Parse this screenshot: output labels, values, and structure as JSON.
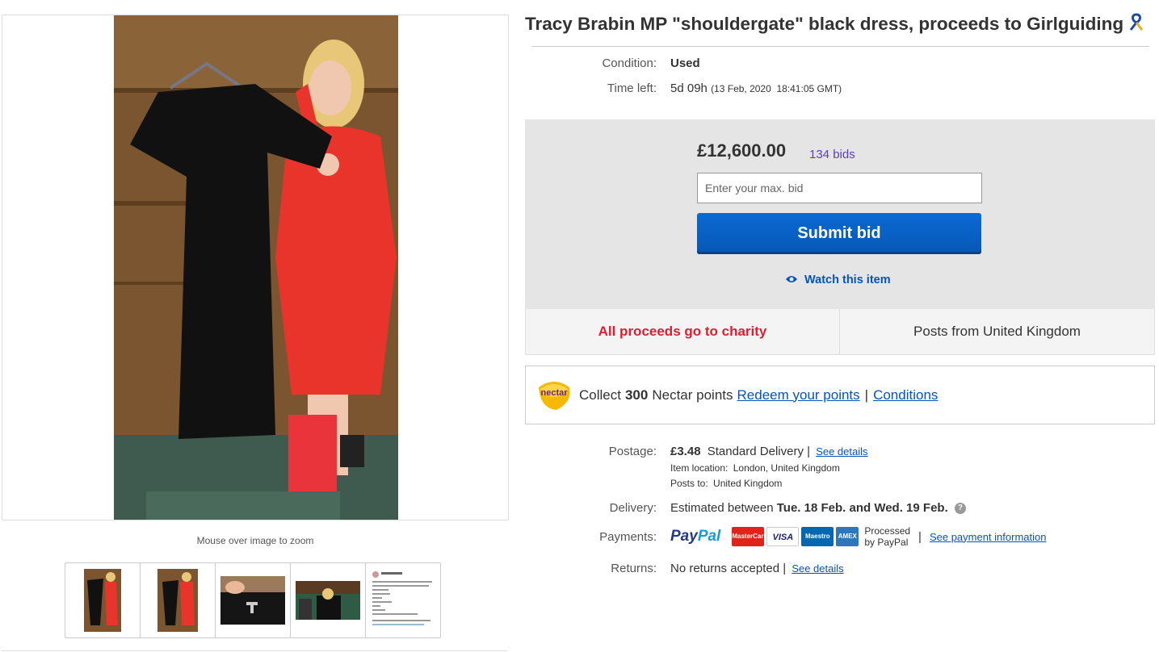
{
  "listing": {
    "title": "Tracy Brabin MP \"shouldergate\" black dress, proceeds to Girlguiding",
    "title_icon": "charity-ribbon-icon"
  },
  "gallery": {
    "zoom_hint": "Mouse over image to zoom",
    "thumbnail_count": 5
  },
  "details": {
    "condition_label": "Condition:",
    "condition_value": "Used",
    "time_left_label": "Time left:",
    "time_left_value": "5d 09h",
    "time_left_end": "(13 Feb, 2020  18:41:05 GMT)"
  },
  "bidding": {
    "current_price": "£12,600.00",
    "bid_count": "134 bids",
    "max_bid_placeholder": "Enter your max. bid",
    "submit_label": "Submit bid",
    "watch_label": "Watch this item"
  },
  "badges": {
    "charity": "All proceeds go to charity",
    "posts_from": "Posts from United Kingdom"
  },
  "nectar": {
    "collect_prefix": "Collect",
    "points": "300",
    "collect_suffix": "Nectar points",
    "redeem_link": "Redeem your points",
    "separator": "|",
    "conditions_link": "Conditions",
    "logo_text": "nectar"
  },
  "postage": {
    "label": "Postage:",
    "price": "£3.48",
    "service": "Standard Delivery |",
    "details_link": "See details",
    "location_label": "Item location:",
    "location_value": "London, United Kingdom",
    "posts_to_label": "Posts to:",
    "posts_to_value": "United Kingdom"
  },
  "delivery": {
    "label": "Delivery:",
    "prefix": "Estimated between",
    "dates": "Tue. 18 Feb. and Wed. 19 Feb.",
    "help_icon": "help-icon"
  },
  "payments": {
    "label": "Payments:",
    "paypal_first": "Pay",
    "paypal_second": "Pal",
    "cards": [
      "MasterCard",
      "VISA",
      "Maestro",
      "AMEX"
    ],
    "processed_line1": "Processed",
    "processed_line2": "by PayPal",
    "separator": "|",
    "info_link": "See payment information"
  },
  "returns": {
    "label": "Returns:",
    "value": "No returns accepted |",
    "details_link": "See details"
  },
  "colors": {
    "link_blue": "#0654ba",
    "charity_red": "#dd1e31",
    "button_blue": "#0757b5",
    "bids_purple": "#5f3bbf"
  }
}
